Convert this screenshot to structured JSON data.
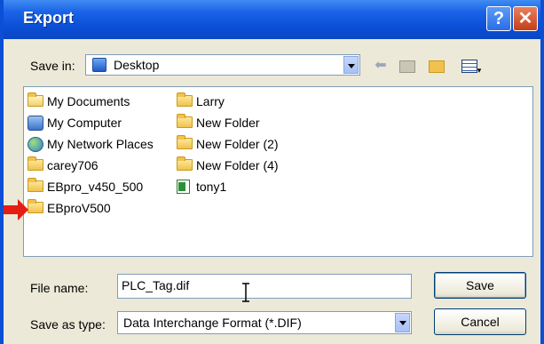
{
  "window": {
    "title": "Export",
    "help_glyph": "?",
    "close_glyph": "✕"
  },
  "save_in": {
    "label": "Save in:",
    "value": "Desktop"
  },
  "toolbar": [
    "back-icon",
    "up-folder-icon",
    "new-folder-icon",
    "views-menu-icon"
  ],
  "files": {
    "column1": [
      {
        "name": "My Documents",
        "icon": "my-documents-icon"
      },
      {
        "name": "My Computer",
        "icon": "my-computer-icon"
      },
      {
        "name": "My Network Places",
        "icon": "network-places-icon"
      },
      {
        "name": "carey706",
        "icon": "folder-icon"
      },
      {
        "name": "EBpro_v450_500",
        "icon": "folder-icon"
      },
      {
        "name": "EBproV500",
        "icon": "folder-icon"
      }
    ],
    "column2": [
      {
        "name": "Larry",
        "icon": "folder-icon"
      },
      {
        "name": "New Folder",
        "icon": "folder-icon"
      },
      {
        "name": "New Folder (2)",
        "icon": "folder-icon"
      },
      {
        "name": "New Folder (4)",
        "icon": "folder-icon"
      },
      {
        "name": "tony1",
        "icon": "excel-file-icon"
      }
    ]
  },
  "file_name": {
    "label": "File name:",
    "value": "PLC_Tag.dif"
  },
  "save_as_type": {
    "label": "Save as type:",
    "value": "Data Interchange Format (*.DIF)"
  },
  "buttons": {
    "save": "Save",
    "cancel": "Cancel"
  },
  "colors": {
    "titlebar": "#0a4fd6",
    "dialog_bg": "#ece9d8",
    "arrow": "#e41e13",
    "close": "#c33e1a"
  }
}
